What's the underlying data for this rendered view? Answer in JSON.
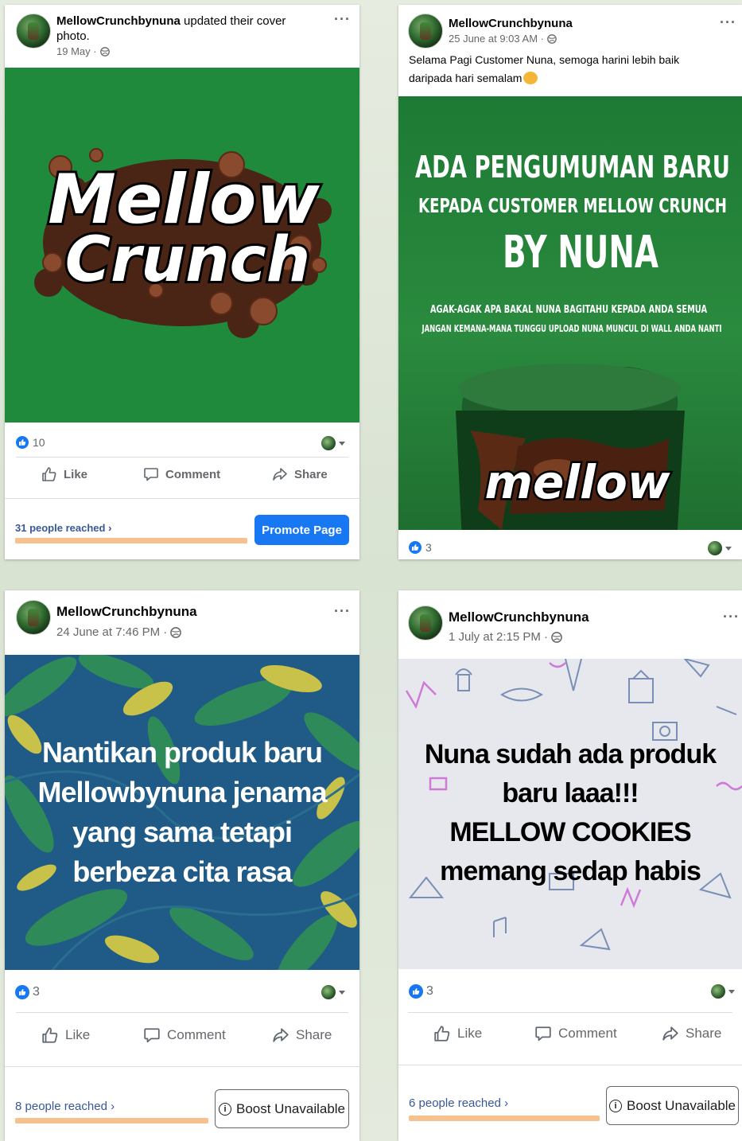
{
  "posts": [
    {
      "page_name": "MellowCrunchbynuna",
      "action": "updated their cover",
      "action_line2": "photo.",
      "date": "19 May ·",
      "image_text": {
        "line1": "Mellow",
        "line2": "Crunch"
      },
      "like_count": "10",
      "actions": {
        "like": "Like",
        "comment": "Comment",
        "share": "Share"
      },
      "reached": "31 people reached",
      "cta": "Promote Page"
    },
    {
      "page_name": "MellowCrunchbynuna",
      "date": "25 June at 9:03 AM ·",
      "caption_line1": "Selama Pagi Customer Nuna, semoga harini lebih baik",
      "caption_line2": "daripada hari semalam",
      "image_text": {
        "headline": "ADA PENGUMUMAN BARU",
        "sub": "KEPADA CUSTOMER MELLOW CRUNCH",
        "big": "BY NUNA",
        "small1": "AGAK-AGAK APA BAKAL NUNA BAGITAHU KEPADA ANDA SEMUA",
        "small2": "JANGAN KEMANA-MANA TUNGGU UPLOAD NUNA MUNCUL DI WALL ANDA NANTI",
        "jar_label": "mellow"
      },
      "like_count": "3"
    },
    {
      "page_name": "MellowCrunchbynuna",
      "date": "24 June at 7:46 PM ·",
      "image_text": [
        "Nantikan produk baru",
        "Mellowbynuna jenama",
        "yang sama tetapi",
        "berbeza cita rasa"
      ],
      "like_count": "3",
      "actions": {
        "like": "Like",
        "comment": "Comment",
        "share": "Share"
      },
      "reached": "8 people reached",
      "cta": "Boost Unavailable"
    },
    {
      "page_name": "MellowCrunchbynuna",
      "date": "1 July at 2:15 PM ·",
      "image_text": [
        "Nuna sudah ada produk",
        "baru laaa!!!",
        "MELLOW COOKIES",
        "memang sedap habis"
      ],
      "like_count": "3",
      "actions": {
        "like": "Like",
        "comment": "Comment",
        "share": "Share"
      },
      "reached": "6 people reached",
      "cta": "Boost Unavailable"
    }
  ],
  "colors": {
    "brand_green": "#1f8a3c",
    "fb_blue": "#1877f2",
    "reach_bar": "#f7c08f",
    "leaf_bg": "#1f5b86"
  }
}
